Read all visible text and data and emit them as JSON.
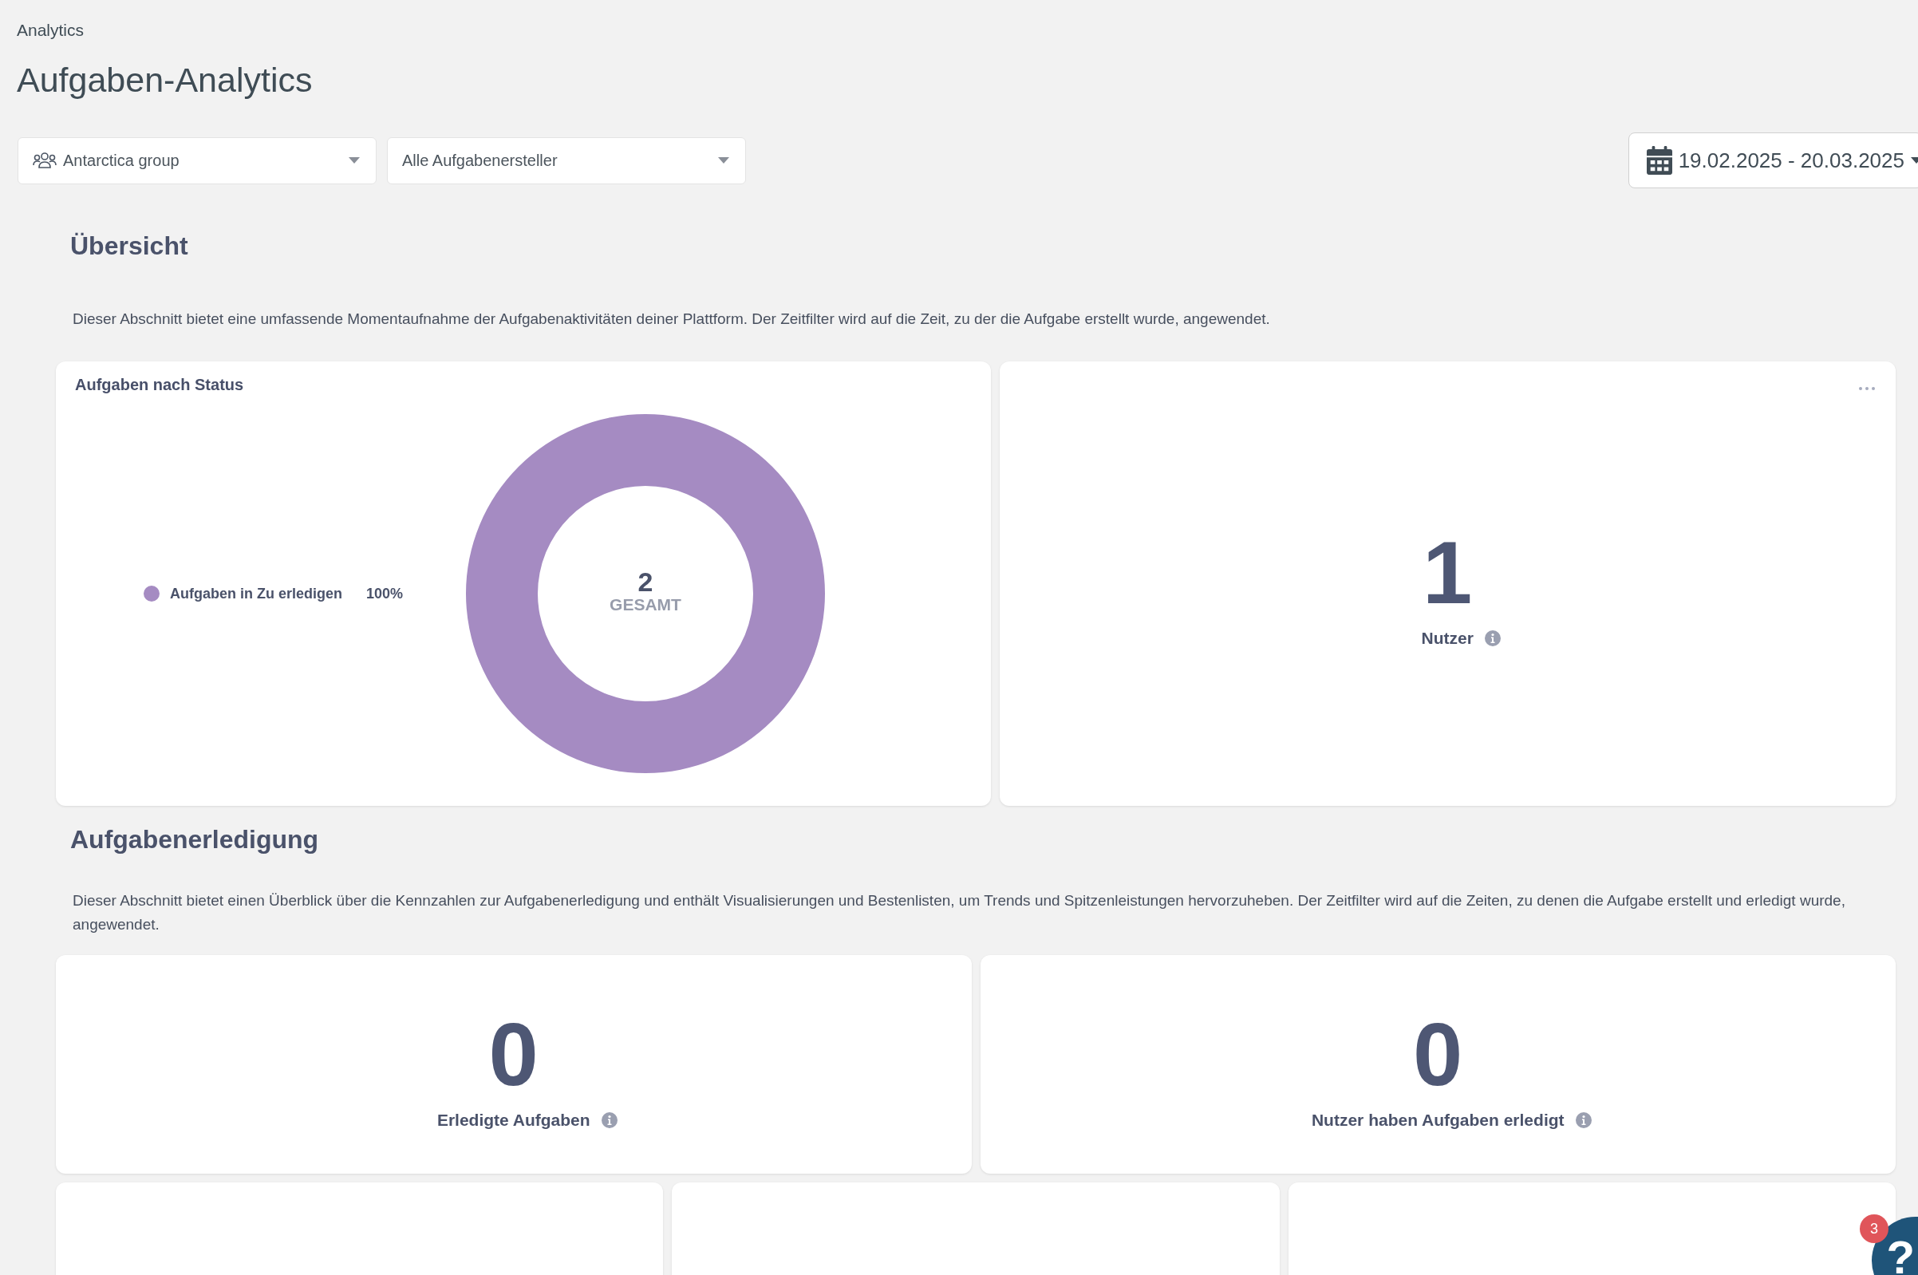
{
  "breadcrumb": "Analytics",
  "title": "Aufgaben-Analytics",
  "filters": [
    {
      "kind": "group",
      "value": "Antarctica group"
    },
    {
      "kind": "plain",
      "value": "Alle Aufgabenersteller"
    }
  ],
  "date_range": "19.02.2025 - 20.03.2025",
  "sections": [
    {
      "heading": "Übersicht",
      "description": "Dieser Abschnitt bietet eine umfassende Momentaufnahme der Aufgabenaktivitäten deiner Plattform. Der Zeitfilter wird auf die Zeit, zu der die Aufgabe erstellt wurde, angewendet.",
      "rows": [
        [
          {
            "kind": "donut",
            "title": "Aufgaben nach Status",
            "legend": [
              {
                "label": "Aufgaben in Zu erledigen",
                "percent": "100%",
                "color": "#a58bc2"
              }
            ],
            "center_value": "2",
            "center_label": "GESAMT"
          },
          {
            "kind": "metric",
            "value": "1",
            "label": "Nutzer",
            "info": true,
            "menu": true
          }
        ]
      ]
    },
    {
      "heading": "Aufgabenerledigung",
      "description": "Dieser Abschnitt bietet einen Überblick über die Kennzahlen zur Aufgabenerledigung und enthält Visualisierungen und Bestenlisten, um Trends und Spitzenleistungen hervorzuheben. Der Zeitfilter wird auf die Zeiten, zu denen die Aufgabe erstellt und erledigt wurde, angewendet.",
      "rows": [
        [
          {
            "kind": "metric",
            "value": "0",
            "label": "Erledigte Aufgaben",
            "info": true,
            "menu": false
          },
          {
            "kind": "metric",
            "value": "0",
            "label": "Nutzer haben Aufgaben erledigt",
            "info": true,
            "menu": false
          }
        ],
        [
          {
            "kind": "partial"
          },
          {
            "kind": "partial"
          },
          {
            "kind": "partial"
          }
        ]
      ]
    }
  ],
  "help": {
    "symbol": "?",
    "badge": "3"
  }
}
